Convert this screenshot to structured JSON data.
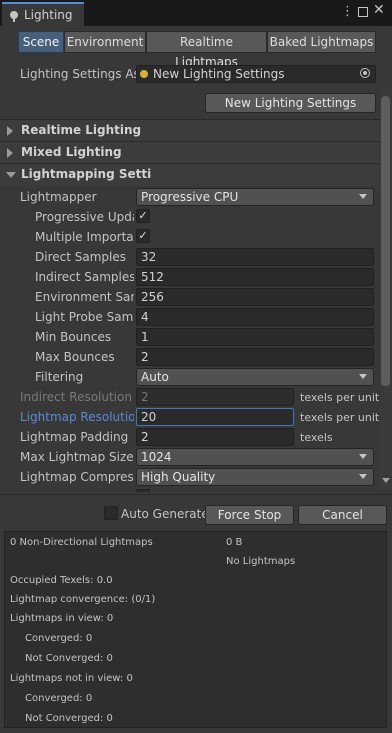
{
  "window": {
    "tab_title": "Lighting",
    "menu_glyph": "⋮",
    "close_glyph": "✕"
  },
  "tabs": [
    "Scene",
    "Environment",
    "Realtime Lightmaps",
    "Baked Lightmaps"
  ],
  "active_tab": 0,
  "settings_asset": {
    "label": "Lighting Settings Asset",
    "value": "New Lighting Settings",
    "new_button": "New Lighting Settings"
  },
  "sections": {
    "realtime": "Realtime Lighting",
    "mixed": "Mixed Lighting",
    "lightmapping": "Lightmapping Settings"
  },
  "lightmapping": {
    "lightmapper_label": "Lightmapper",
    "lightmapper_value": "Progressive CPU",
    "progressive_updates_label": "Progressive Updates",
    "progressive_updates_checked": "✓",
    "multiple_importance_label": "Multiple Importance Sampling",
    "multiple_importance_checked": "✓",
    "direct_samples_label": "Direct Samples",
    "direct_samples_value": "32",
    "indirect_samples_label": "Indirect Samples",
    "indirect_samples_value": "512",
    "environment_samples_label": "Environment Samples",
    "environment_samples_value": "256",
    "light_probe_label": "Light Probe Sample Count Multiplier",
    "light_probe_value": "4",
    "min_bounces_label": "Min Bounces",
    "min_bounces_value": "1",
    "max_bounces_label": "Max Bounces",
    "max_bounces_value": "2",
    "filtering_label": "Filtering",
    "filtering_value": "Auto",
    "indirect_resolution_label": "Indirect Resolution",
    "indirect_resolution_value": "2",
    "indirect_resolution_unit": "texels per unit",
    "lightmap_resolution_label": "Lightmap Resolution",
    "lightmap_resolution_value": "20",
    "lightmap_resolution_unit": "texels per unit",
    "lightmap_padding_label": "Lightmap Padding",
    "lightmap_padding_value": "2",
    "lightmap_padding_unit": "texels",
    "max_lightmap_size_label": "Max Lightmap Size",
    "max_lightmap_size_value": "1024",
    "lightmap_compression_label": "Lightmap Compression",
    "lightmap_compression_value": "High Quality"
  },
  "bake_bar": {
    "auto_generate_label": "Auto Generate",
    "force_stop": "Force Stop",
    "cancel": "Cancel"
  },
  "stats": {
    "lightmaps_count": "0 Non-Directional Lightmaps",
    "size": "0 B",
    "no_lightmaps": "No Lightmaps",
    "occupied_texels": "Occupied Texels: 0.0",
    "convergence": "Lightmap convergence: (0/1)",
    "in_view": "Lightmaps in view: 0",
    "in_view_converged": "Converged: 0",
    "in_view_not_converged": "Not Converged: 0",
    "not_in_view": "Lightmaps not in view: 0",
    "not_in_view_converged": "Converged: 0",
    "not_in_view_not_converged": "Not Converged: 0"
  },
  "colors": {
    "accent": "#5a8ad6",
    "active_tab": "#46607c",
    "background": "#383838"
  }
}
